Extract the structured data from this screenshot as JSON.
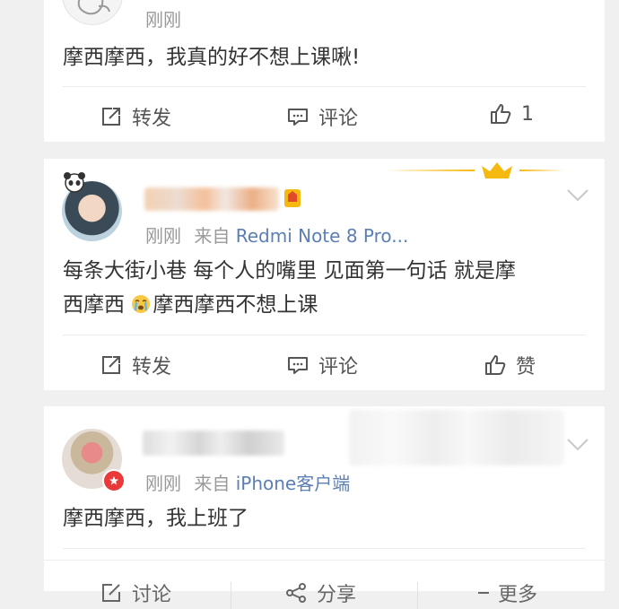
{
  "post1": {
    "time": "刚刚",
    "text": "摩西摩西，我真的好不想上课啾!",
    "actions": {
      "repost": "转发",
      "comment": "评论",
      "like_count": "1"
    }
  },
  "post2": {
    "time": "刚刚",
    "from_label": "来自",
    "source": "Redmi Note 8 Pro...",
    "text_line1": "每条大街小巷 每个人的嘴里 见面第一句话 就是摩",
    "text_line2_a": "西摩西 ",
    "text_line2_b": "摩西摩西不想上课",
    "emoji": "crying-face-icon",
    "actions": {
      "repost": "转发",
      "comment": "评论",
      "like": "赞"
    }
  },
  "post3": {
    "time": "刚刚",
    "from_label": "来自",
    "source": "iPhone客户端",
    "text": "摩西摩西，我上班了"
  },
  "bottom_bar": {
    "discuss": "讨论",
    "share": "分享",
    "more": "更多"
  },
  "colors": {
    "link": "#5b7fb4",
    "crown": "#f5b90f",
    "badge": "#e83a3a"
  }
}
